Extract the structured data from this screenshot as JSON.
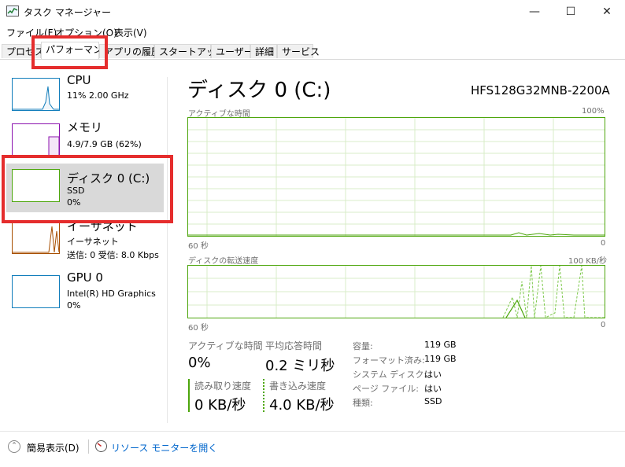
{
  "window": {
    "title": "タスク マネージャー",
    "minimize": "—",
    "maximize": "☐",
    "close": "✕"
  },
  "menu": [
    "ファイル(F)",
    "オプション(O)",
    "表示(V)"
  ],
  "tabs": [
    "プロセス",
    "パフォーマンス",
    "アプリの履歴",
    "スタートアップ",
    "ユーザー",
    "詳細",
    "サービス"
  ],
  "sidebar": [
    {
      "title": "CPU",
      "sub1": "11%  2.00 GHz",
      "sub2": "",
      "sub3": "",
      "color": "#117dbb",
      "selected": false
    },
    {
      "title": "メモリ",
      "sub1": "4.9/7.9 GB (62%)",
      "sub2": "",
      "sub3": "",
      "color": "#8b12ae",
      "selected": false
    },
    {
      "title": "ディスク 0 (C:)",
      "sub1": "SSD",
      "sub2": "0%",
      "sub3": "",
      "color": "#4da60c",
      "selected": true
    },
    {
      "title": "イーサネット",
      "sub1": "イーサネット",
      "sub2": "送信: 0  受信: 8.0 Kbps",
      "sub3": "",
      "color": "#a74f01",
      "selected": false
    },
    {
      "title": "GPU 0",
      "sub1": "Intel(R) HD Graphics",
      "sub2": "0%",
      "sub3": "",
      "color": "#117dbb",
      "selected": false
    }
  ],
  "main": {
    "title": "ディスク 0 (C:)",
    "model": "HFS128G32MNB-2200A",
    "graph1": {
      "label_left": "アクティブな時間",
      "label_right": "100%",
      "bottom_left": "60 秒",
      "bottom_right": "0"
    },
    "graph2": {
      "label_left": "ディスクの転送速度",
      "label_right": "100 KB/秒",
      "bottom_left": "60 秒",
      "bottom_right": "0"
    },
    "stats": {
      "active_time_label": "アクティブな時間",
      "active_time_value": "0%",
      "response_label": "平均応答時間",
      "response_value": "0.2 ミリ秒",
      "read_label": "読み取り速度",
      "read_value": "0 KB/秒",
      "write_label": "書き込み速度",
      "write_value": "4.0 KB/秒"
    },
    "props": [
      {
        "label": "容量:",
        "value": "119 GB"
      },
      {
        "label": "フォーマット済み:",
        "value": "119 GB"
      },
      {
        "label": "システム ディスク:",
        "value": "はい"
      },
      {
        "label": "ページ ファイル:",
        "value": "はい"
      },
      {
        "label": "種類:",
        "value": "SSD"
      }
    ]
  },
  "bottom": {
    "fewer_details": "簡易表示(D)",
    "resource_monitor": "リソース モニターを開く"
  },
  "colors": {
    "disk": "#4da60c",
    "cpu": "#117dbb",
    "memory": "#8b12ae",
    "ethernet": "#a74f01",
    "highlight": "#e52d2d"
  }
}
